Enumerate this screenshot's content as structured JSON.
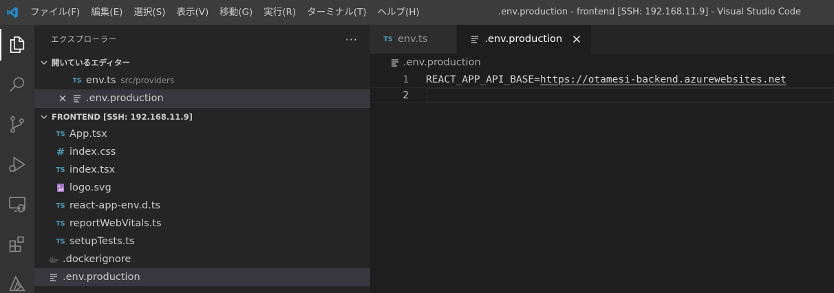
{
  "menu": [
    "ファイル(F)",
    "編集(E)",
    "選択(S)",
    "表示(V)",
    "移動(G)",
    "実行(R)",
    "ターミナル(T)",
    "ヘルプ(H)"
  ],
  "window_title": ".env.production - frontend [SSH: 192.168.11.9] - Visual Studio Code",
  "activity_bar": [
    "files-icon",
    "search-icon",
    "source-control-icon",
    "run-debug-icon",
    "remote-explorer-icon",
    "extensions-icon",
    "azure-icon"
  ],
  "sidebar": {
    "title": "エクスプローラー",
    "more": "···",
    "open_editors": {
      "header": "開いているエディター",
      "items": [
        {
          "name": "env.ts",
          "desc": "src/providers",
          "icon": "TS"
        },
        {
          "name": ".env.production",
          "desc": "",
          "icon": "lines"
        }
      ]
    },
    "folder": {
      "header": "FRONTEND [SSH: 192.168.11.9]",
      "items": [
        {
          "name": "App.tsx",
          "icon": "TS"
        },
        {
          "name": "index.css",
          "icon": "#"
        },
        {
          "name": "index.tsx",
          "icon": "TS"
        },
        {
          "name": "logo.svg",
          "icon": "svg"
        },
        {
          "name": "react-app-env.d.ts",
          "icon": "TS"
        },
        {
          "name": "reportWebVitals.ts",
          "icon": "TS"
        },
        {
          "name": "setupTests.ts",
          "icon": "TS"
        },
        {
          "name": ".dockerignore",
          "icon": "docker"
        },
        {
          "name": ".env.production",
          "icon": "lines"
        }
      ]
    }
  },
  "editor": {
    "tabs": [
      {
        "label": "env.ts",
        "icon": "TS",
        "active": false
      },
      {
        "label": ".env.production",
        "icon": "lines",
        "active": true
      }
    ],
    "breadcrumb": ".env.production",
    "lines": [
      {
        "number": "1",
        "key": "REACT_APP_API_BASE=",
        "url": "https://otamesi-backend.azurewebsites.net"
      },
      {
        "number": "2",
        "key": "",
        "url": ""
      }
    ]
  },
  "colors": {
    "accent": "#0078d4",
    "ts_icon": "#519aba",
    "titlebar": "#3c3c3c",
    "sidebar": "#252526",
    "editor": "#1e1e1e"
  }
}
